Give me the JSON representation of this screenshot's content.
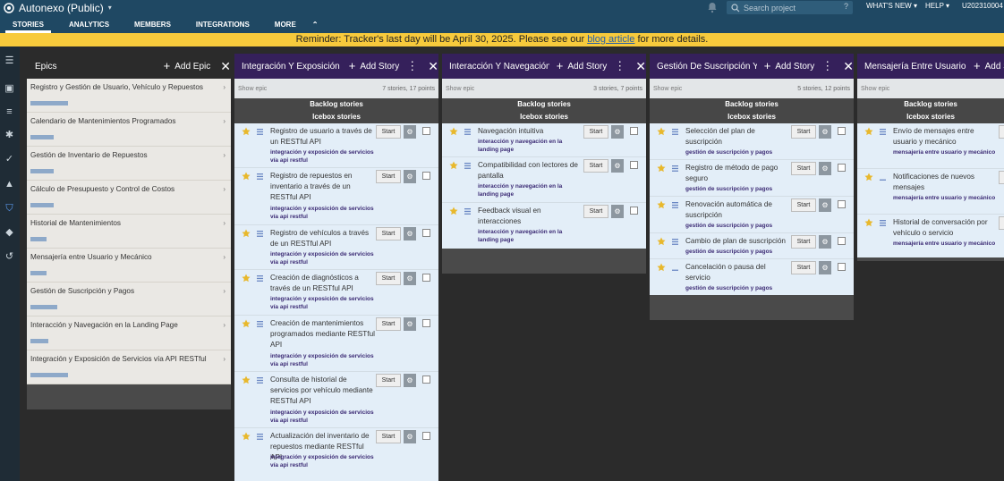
{
  "topbar": {
    "project_title": "Autonexo (Public)",
    "search_placeholder": "Search project",
    "search_help": "?",
    "whats_new": "WHAT'S NEW",
    "help": "HELP",
    "user": "U202310004"
  },
  "nav": {
    "tabs": [
      "STORIES",
      "ANALYTICS",
      "MEMBERS",
      "INTEGRATIONS",
      "MORE"
    ]
  },
  "banner": {
    "before": "Reminder: Tracker's last day will be April 30, 2025. Please see our ",
    "link": "blog article",
    "after": " for more details."
  },
  "epics": {
    "title": "Epics",
    "add": "Add Epic",
    "items": [
      "Registro y Gestión de Usuario, Vehículo y Repuestos",
      "Calendario de Mantenimientos Programados",
      "Gestión de Inventario de Repuestos",
      "Cálculo de Presupuesto y Control de Costos",
      "Historial de Mantenimientos",
      "Mensajería entre Usuario y Mecánico",
      "Gestión de Suscripción y Pagos",
      "Interacción y Navegación en la Landing Page",
      "Integración y Exposición de Servicios vía API RESTful"
    ]
  },
  "common": {
    "show_epic": "Show epic",
    "add_story": "Add Story",
    "backlog": "Backlog stories",
    "icebox": "Icebox stories",
    "start": "Start"
  },
  "columns": [
    {
      "title": "Integración Y Exposición D...",
      "count": "7 stories, 17 points",
      "stories": [
        {
          "title": "Registro de usuario a través de un RESTful API",
          "label": "integración y exposición de servicios vía api restful"
        },
        {
          "title": "Registro de repuestos en inventario a través de un RESTful API",
          "label": "integración y exposición de servicios vía api restful"
        },
        {
          "title": "Registro de vehículos a través de un RESTful API",
          "label": "integración y exposición de servicios vía api restful"
        },
        {
          "title": "Creación de diagnósticos a través de un RESTful API",
          "label": "integración y exposición de servicios vía api restful"
        },
        {
          "title": "Creación de mantenimientos programados mediante RESTful API",
          "label": "integración y exposición de servicios vía api restful"
        },
        {
          "title": "Consulta de historial de servicios por vehículo mediante RESTful API",
          "label": "integración y exposición de servicios vía api restful"
        },
        {
          "title": "Actualización del inventario de repuestos mediante RESTful API",
          "label": "integración y exposición de servicios vía api restful"
        }
      ]
    },
    {
      "title": "Interacción Y Navegación E...",
      "count": "3 stories, 7 points",
      "stories": [
        {
          "title": "Navegación intuitiva",
          "label": "interacción y navegación en la landing page"
        },
        {
          "title": "Compatibilidad con lectores de pantalla",
          "label": "interacción y navegación en la landing page"
        },
        {
          "title": "Feedback visual en interacciones",
          "label": "interacción y navegación en la landing page"
        }
      ]
    },
    {
      "title": "Gestión De Suscripción Y P...",
      "count": "5 stories, 12 points",
      "stories": [
        {
          "title": "Selección del plan de suscripción",
          "label": "gestión de suscripción y pagos"
        },
        {
          "title": "Registro de método de pago seguro",
          "label": "gestión de suscripción y pagos"
        },
        {
          "title": "Renovación automática de suscripción",
          "label": "gestión de suscripción y pagos"
        },
        {
          "title": "Cambio de plan de suscripción",
          "label": "gestión de suscripción y pagos"
        },
        {
          "title": "Cancelación o pausa del servicio",
          "label": "gestión de suscripción y pagos"
        }
      ]
    },
    {
      "title": "Mensajería Entre Usuario Y...",
      "count": "",
      "stories": [
        {
          "title": "Envío de mensajes entre usuario y mecánico",
          "label": "mensajería entre usuario y mecánico"
        },
        {
          "title": "Notificaciones de nuevos mensajes",
          "label": "mensajería entre usuario y mecánico"
        },
        {
          "title": "Historial de conversación por vehículo o servicio",
          "label": "mensajería entre usuario y mecánico"
        }
      ]
    }
  ],
  "colors": {
    "header": "#1f4863",
    "banner": "#f7ca3c",
    "column_header": "#35205b",
    "star": "#e8b82c",
    "story_bg": "#e3eef8"
  }
}
